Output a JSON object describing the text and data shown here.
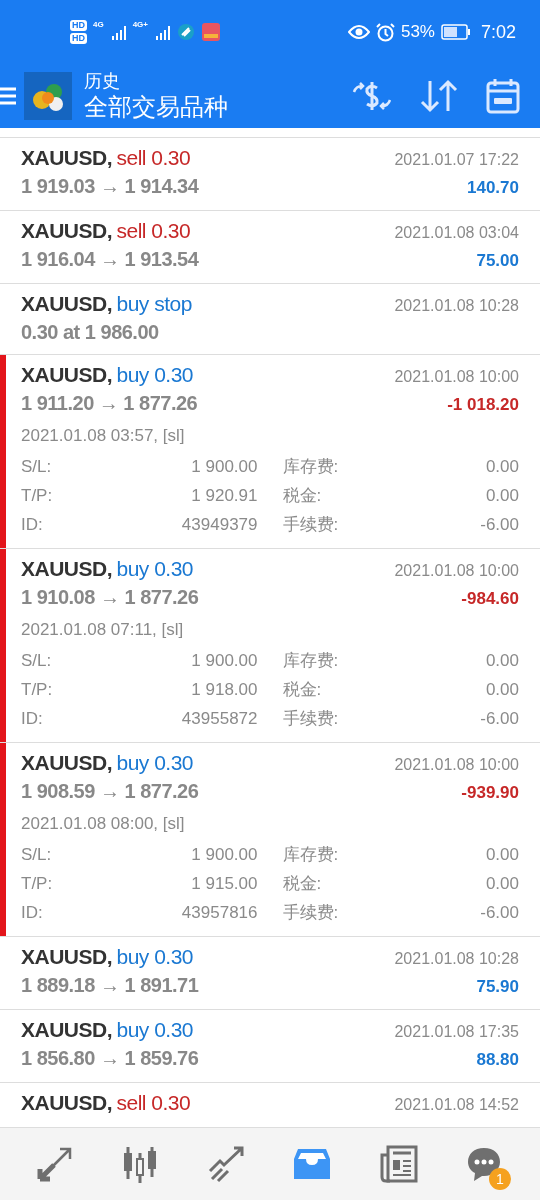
{
  "status_bar": {
    "sim_labels": [
      "HD",
      "HD"
    ],
    "networks": [
      "4G",
      "4G+"
    ],
    "battery": "53%",
    "time": "7:02"
  },
  "toolbar": {
    "title": "历史",
    "subtitle": "全部交易品种"
  },
  "trades": [
    {
      "symbol": "XAUUSD,",
      "side": "sell 0.30",
      "kind": "sell",
      "time": "2021.01.07 17:22",
      "prices": "1 919.03 → 1 914.34",
      "profit": "140.70",
      "loss": false,
      "expanded": false
    },
    {
      "symbol": "XAUUSD,",
      "side": "sell 0.30",
      "kind": "sell",
      "time": "2021.01.08 03:04",
      "prices": "1 916.04 → 1 913.54",
      "profit": "75.00",
      "loss": false,
      "expanded": false
    },
    {
      "symbol": "XAUUSD,",
      "side": "buy stop",
      "kind": "buy",
      "time": "2021.01.08 10:28",
      "prices": "0.30 at 1 986.00",
      "expanded": false
    },
    {
      "symbol": "XAUUSD,",
      "side": "buy 0.30",
      "kind": "buy",
      "time": "2021.01.08 10:00",
      "prices": "1 911.20 → 1 877.26",
      "profit": "-1 018.20",
      "loss": true,
      "expanded": true,
      "note": "2021.01.08 03:57, [sl]",
      "details": [
        [
          "S/L:",
          "1 900.00",
          "库存费:",
          "0.00"
        ],
        [
          "T/P:",
          "1 920.91",
          "税金:",
          "0.00"
        ],
        [
          "ID:",
          "43949379",
          "手续费:",
          "-6.00"
        ]
      ]
    },
    {
      "symbol": "XAUUSD,",
      "side": "buy 0.30",
      "kind": "buy",
      "time": "2021.01.08 10:00",
      "prices": "1 910.08 → 1 877.26",
      "profit": "-984.60",
      "loss": true,
      "expanded": true,
      "note": "2021.01.08 07:11, [sl]",
      "details": [
        [
          "S/L:",
          "1 900.00",
          "库存费:",
          "0.00"
        ],
        [
          "T/P:",
          "1 918.00",
          "税金:",
          "0.00"
        ],
        [
          "ID:",
          "43955872",
          "手续费:",
          "-6.00"
        ]
      ]
    },
    {
      "symbol": "XAUUSD,",
      "side": "buy 0.30",
      "kind": "buy",
      "time": "2021.01.08 10:00",
      "prices": "1 908.59 → 1 877.26",
      "profit": "-939.90",
      "loss": true,
      "expanded": true,
      "note": "2021.01.08 08:00, [sl]",
      "details": [
        [
          "S/L:",
          "1 900.00",
          "库存费:",
          "0.00"
        ],
        [
          "T/P:",
          "1 915.00",
          "税金:",
          "0.00"
        ],
        [
          "ID:",
          "43957816",
          "手续费:",
          "-6.00"
        ]
      ]
    },
    {
      "symbol": "XAUUSD,",
      "side": "buy 0.30",
      "kind": "buy",
      "time": "2021.01.08 10:28",
      "prices": "1 889.18 → 1 891.71",
      "profit": "75.90",
      "loss": false,
      "expanded": false
    },
    {
      "symbol": "XAUUSD,",
      "side": "buy 0.30",
      "kind": "buy",
      "time": "2021.01.08 17:35",
      "prices": "1 856.80 → 1 859.76",
      "profit": "88.80",
      "loss": false,
      "expanded": false
    },
    {
      "symbol": "XAUUSD,",
      "side": "sell 0.30",
      "kind": "sell",
      "time": "2021.01.08 14:52",
      "expanded": false
    }
  ],
  "nav": [
    {
      "kind": "trade",
      "selected": false
    },
    {
      "kind": "quotes",
      "selected": false
    },
    {
      "kind": "chart",
      "selected": false
    },
    {
      "kind": "history",
      "selected": true
    },
    {
      "kind": "news",
      "selected": false
    },
    {
      "kind": "chat",
      "selected": false,
      "badge": "1"
    }
  ]
}
